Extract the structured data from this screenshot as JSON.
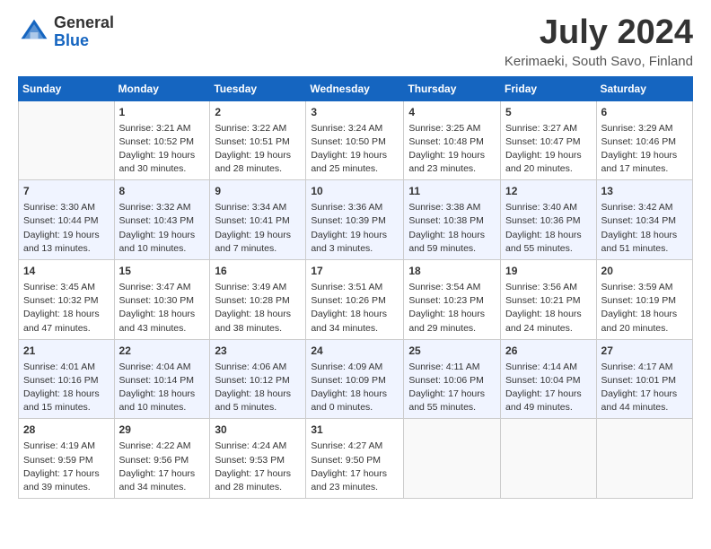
{
  "logo": {
    "text_general": "General",
    "text_blue": "Blue"
  },
  "header": {
    "month_title": "July 2024",
    "location": "Kerimaeki, South Savo, Finland"
  },
  "weekdays": [
    "Sunday",
    "Monday",
    "Tuesday",
    "Wednesday",
    "Thursday",
    "Friday",
    "Saturday"
  ],
  "weeks": [
    [
      {
        "day": "",
        "info": ""
      },
      {
        "day": "1",
        "info": "Sunrise: 3:21 AM\nSunset: 10:52 PM\nDaylight: 19 hours\nand 30 minutes."
      },
      {
        "day": "2",
        "info": "Sunrise: 3:22 AM\nSunset: 10:51 PM\nDaylight: 19 hours\nand 28 minutes."
      },
      {
        "day": "3",
        "info": "Sunrise: 3:24 AM\nSunset: 10:50 PM\nDaylight: 19 hours\nand 25 minutes."
      },
      {
        "day": "4",
        "info": "Sunrise: 3:25 AM\nSunset: 10:48 PM\nDaylight: 19 hours\nand 23 minutes."
      },
      {
        "day": "5",
        "info": "Sunrise: 3:27 AM\nSunset: 10:47 PM\nDaylight: 19 hours\nand 20 minutes."
      },
      {
        "day": "6",
        "info": "Sunrise: 3:29 AM\nSunset: 10:46 PM\nDaylight: 19 hours\nand 17 minutes."
      }
    ],
    [
      {
        "day": "7",
        "info": "Sunrise: 3:30 AM\nSunset: 10:44 PM\nDaylight: 19 hours\nand 13 minutes."
      },
      {
        "day": "8",
        "info": "Sunrise: 3:32 AM\nSunset: 10:43 PM\nDaylight: 19 hours\nand 10 minutes."
      },
      {
        "day": "9",
        "info": "Sunrise: 3:34 AM\nSunset: 10:41 PM\nDaylight: 19 hours\nand 7 minutes."
      },
      {
        "day": "10",
        "info": "Sunrise: 3:36 AM\nSunset: 10:39 PM\nDaylight: 19 hours\nand 3 minutes."
      },
      {
        "day": "11",
        "info": "Sunrise: 3:38 AM\nSunset: 10:38 PM\nDaylight: 18 hours\nand 59 minutes."
      },
      {
        "day": "12",
        "info": "Sunrise: 3:40 AM\nSunset: 10:36 PM\nDaylight: 18 hours\nand 55 minutes."
      },
      {
        "day": "13",
        "info": "Sunrise: 3:42 AM\nSunset: 10:34 PM\nDaylight: 18 hours\nand 51 minutes."
      }
    ],
    [
      {
        "day": "14",
        "info": "Sunrise: 3:45 AM\nSunset: 10:32 PM\nDaylight: 18 hours\nand 47 minutes."
      },
      {
        "day": "15",
        "info": "Sunrise: 3:47 AM\nSunset: 10:30 PM\nDaylight: 18 hours\nand 43 minutes."
      },
      {
        "day": "16",
        "info": "Sunrise: 3:49 AM\nSunset: 10:28 PM\nDaylight: 18 hours\nand 38 minutes."
      },
      {
        "day": "17",
        "info": "Sunrise: 3:51 AM\nSunset: 10:26 PM\nDaylight: 18 hours\nand 34 minutes."
      },
      {
        "day": "18",
        "info": "Sunrise: 3:54 AM\nSunset: 10:23 PM\nDaylight: 18 hours\nand 29 minutes."
      },
      {
        "day": "19",
        "info": "Sunrise: 3:56 AM\nSunset: 10:21 PM\nDaylight: 18 hours\nand 24 minutes."
      },
      {
        "day": "20",
        "info": "Sunrise: 3:59 AM\nSunset: 10:19 PM\nDaylight: 18 hours\nand 20 minutes."
      }
    ],
    [
      {
        "day": "21",
        "info": "Sunrise: 4:01 AM\nSunset: 10:16 PM\nDaylight: 18 hours\nand 15 minutes."
      },
      {
        "day": "22",
        "info": "Sunrise: 4:04 AM\nSunset: 10:14 PM\nDaylight: 18 hours\nand 10 minutes."
      },
      {
        "day": "23",
        "info": "Sunrise: 4:06 AM\nSunset: 10:12 PM\nDaylight: 18 hours\nand 5 minutes."
      },
      {
        "day": "24",
        "info": "Sunrise: 4:09 AM\nSunset: 10:09 PM\nDaylight: 18 hours\nand 0 minutes."
      },
      {
        "day": "25",
        "info": "Sunrise: 4:11 AM\nSunset: 10:06 PM\nDaylight: 17 hours\nand 55 minutes."
      },
      {
        "day": "26",
        "info": "Sunrise: 4:14 AM\nSunset: 10:04 PM\nDaylight: 17 hours\nand 49 minutes."
      },
      {
        "day": "27",
        "info": "Sunrise: 4:17 AM\nSunset: 10:01 PM\nDaylight: 17 hours\nand 44 minutes."
      }
    ],
    [
      {
        "day": "28",
        "info": "Sunrise: 4:19 AM\nSunset: 9:59 PM\nDaylight: 17 hours\nand 39 minutes."
      },
      {
        "day": "29",
        "info": "Sunrise: 4:22 AM\nSunset: 9:56 PM\nDaylight: 17 hours\nand 34 minutes."
      },
      {
        "day": "30",
        "info": "Sunrise: 4:24 AM\nSunset: 9:53 PM\nDaylight: 17 hours\nand 28 minutes."
      },
      {
        "day": "31",
        "info": "Sunrise: 4:27 AM\nSunset: 9:50 PM\nDaylight: 17 hours\nand 23 minutes."
      },
      {
        "day": "",
        "info": ""
      },
      {
        "day": "",
        "info": ""
      },
      {
        "day": "",
        "info": ""
      }
    ]
  ]
}
